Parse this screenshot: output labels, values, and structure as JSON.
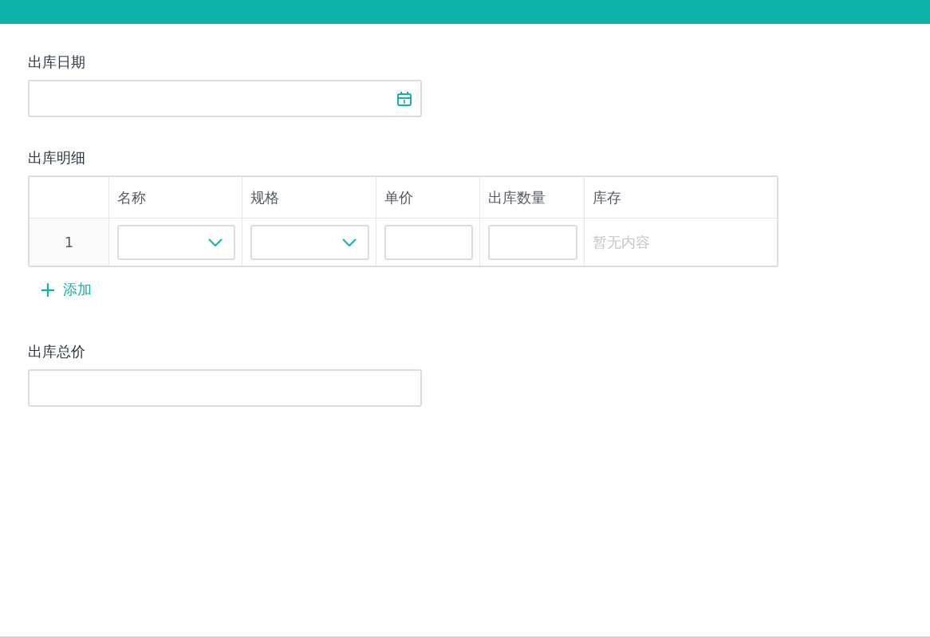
{
  "fields_top": {
    "label": "出库日期"
  },
  "detail": {
    "label": "出库明细",
    "columns": [
      "名称",
      "规格",
      "单价",
      "出库数量",
      "库存"
    ],
    "rows": [
      {
        "index": "1",
        "cells": [
          {
            "kind": "select"
          },
          {
            "kind": "select"
          },
          {
            "kind": "input"
          },
          {
            "kind": "input"
          },
          {
            "kind": "text",
            "text": "暂无内容"
          }
        ]
      }
    ],
    "add_button": {
      "icon": "+",
      "label": "添加"
    }
  },
  "total": {
    "label": "出库总价"
  }
}
